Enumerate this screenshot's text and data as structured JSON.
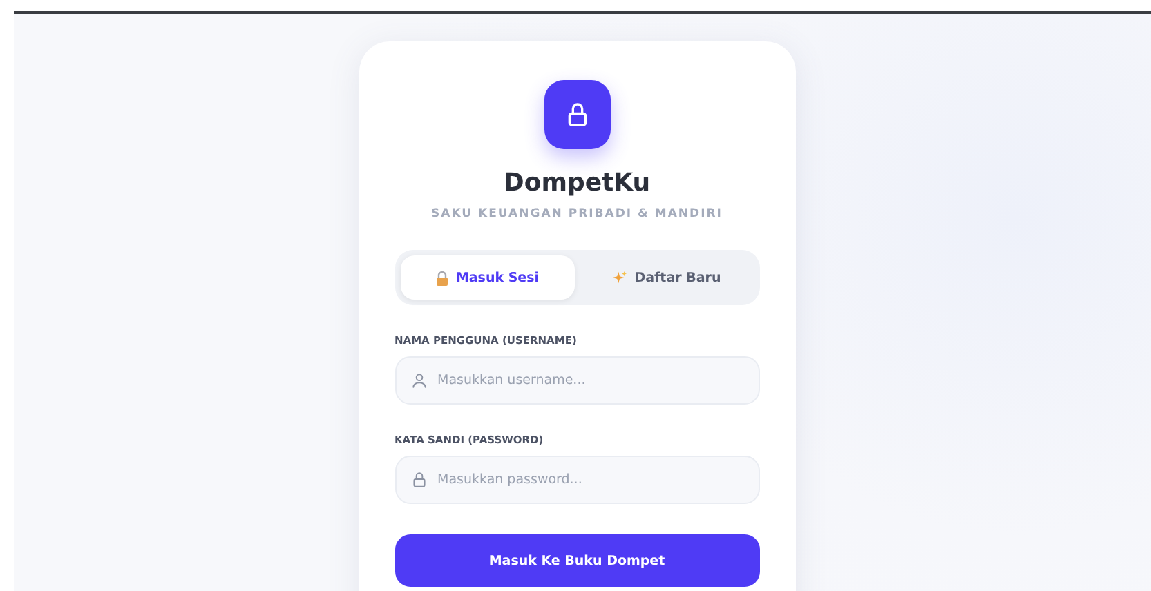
{
  "app": {
    "title": "DompetKu",
    "tagline": "SAKU KEUANGAN PRIBADI & MANDIRI"
  },
  "tabs": [
    {
      "label": "Masuk Sesi",
      "kind": "lock",
      "selected": true
    },
    {
      "label": "Daftar Baru",
      "kind": "sparkle",
      "selected": false
    }
  ],
  "fields": [
    {
      "label": "NAMA PENGGUNA (USERNAME)",
      "kind": "user",
      "placeholder": "Masukkan username..."
    },
    {
      "label": "KATA SANDI (PASSWORD)",
      "kind": "lock",
      "placeholder": "Masukkan password..."
    }
  ],
  "submit": {
    "label": "Masuk Ke Buku Dompet"
  }
}
